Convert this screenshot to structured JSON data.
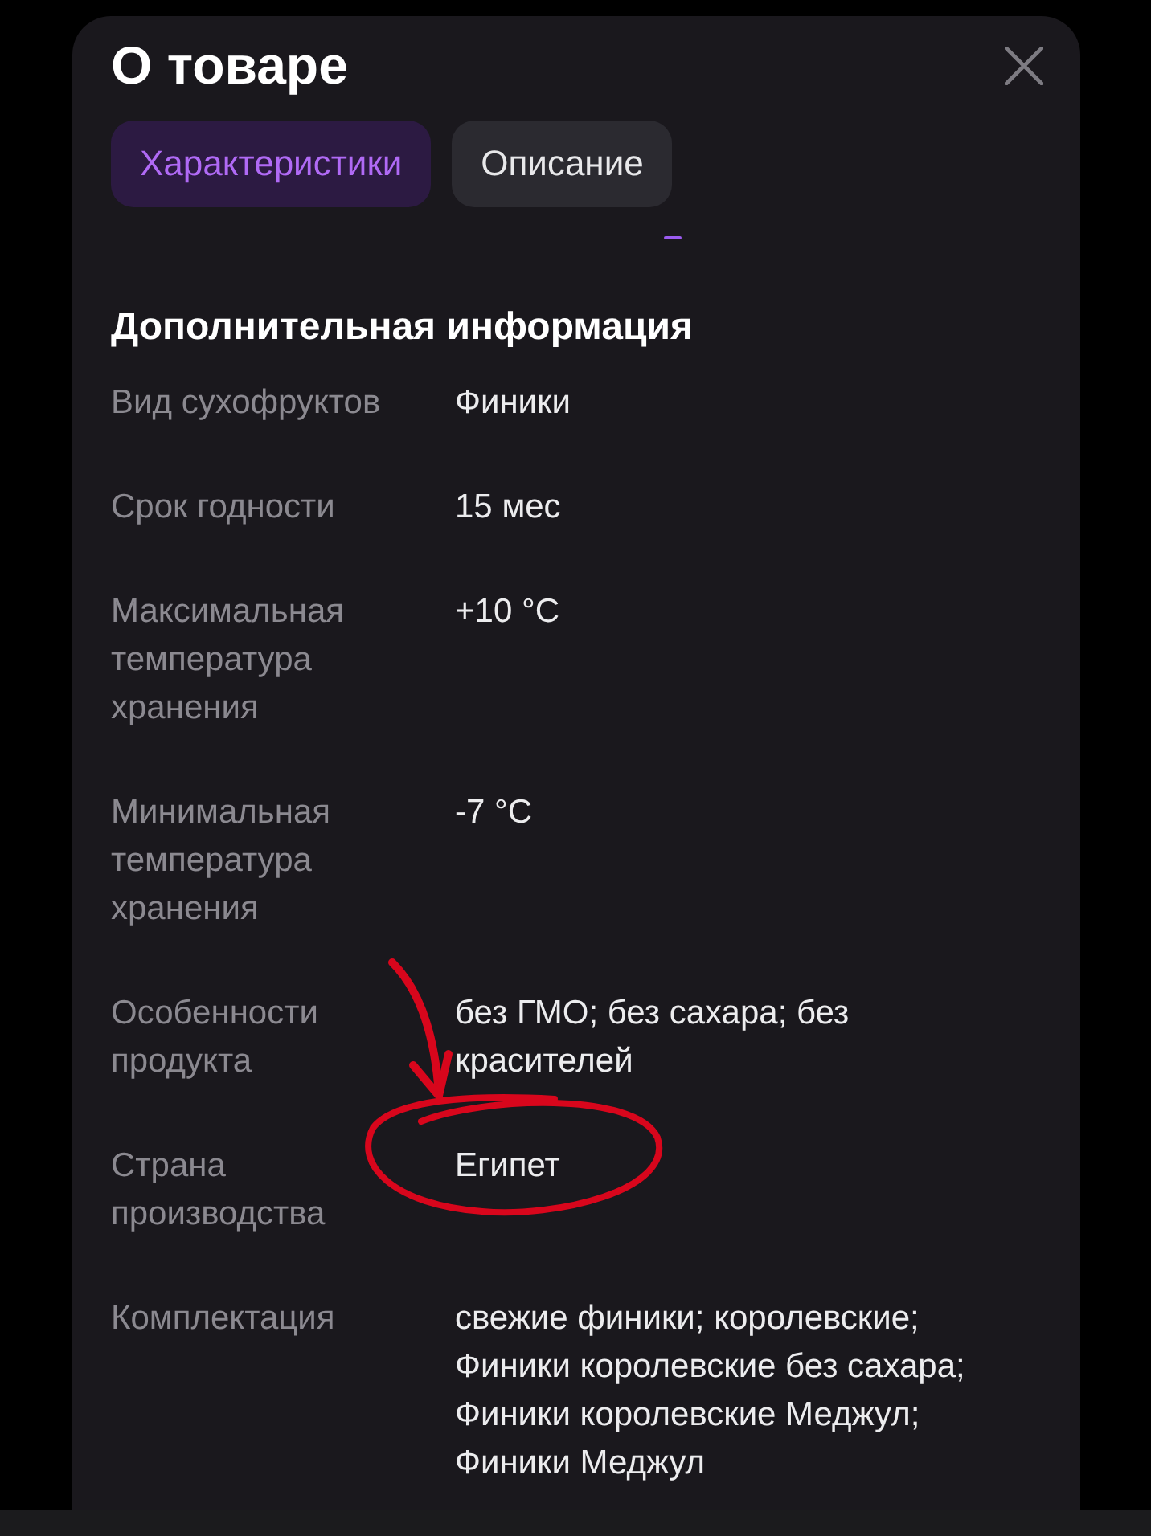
{
  "window": {
    "title": "О товаре"
  },
  "tabs": [
    {
      "label": "Характеристики",
      "selected": true
    },
    {
      "label": "Описание",
      "selected": false
    }
  ],
  "section": {
    "title": "Дополнительная информация",
    "rows": [
      {
        "label": "Вид сухофруктов",
        "value": "Финики",
        "highlighted": false
      },
      {
        "label": "Срок годности",
        "value": "15 мес",
        "highlighted": false
      },
      {
        "label": "Максимальная температура хранения",
        "value": "+10 °C",
        "highlighted": false
      },
      {
        "label": "Минимальная температура хранения",
        "value": "-7 °C",
        "highlighted": false
      },
      {
        "label": "Особенности продукта",
        "value": "без ГМО; без сахара; без красителей",
        "highlighted": false
      },
      {
        "label": "Страна производства",
        "value": "Египет",
        "highlighted": true
      },
      {
        "label": "Комплектация",
        "value": "свежие финики; королевские; Финики королевские без сахара; Финики королевские Меджул; Финики Меджул",
        "highlighted": false
      }
    ]
  }
}
